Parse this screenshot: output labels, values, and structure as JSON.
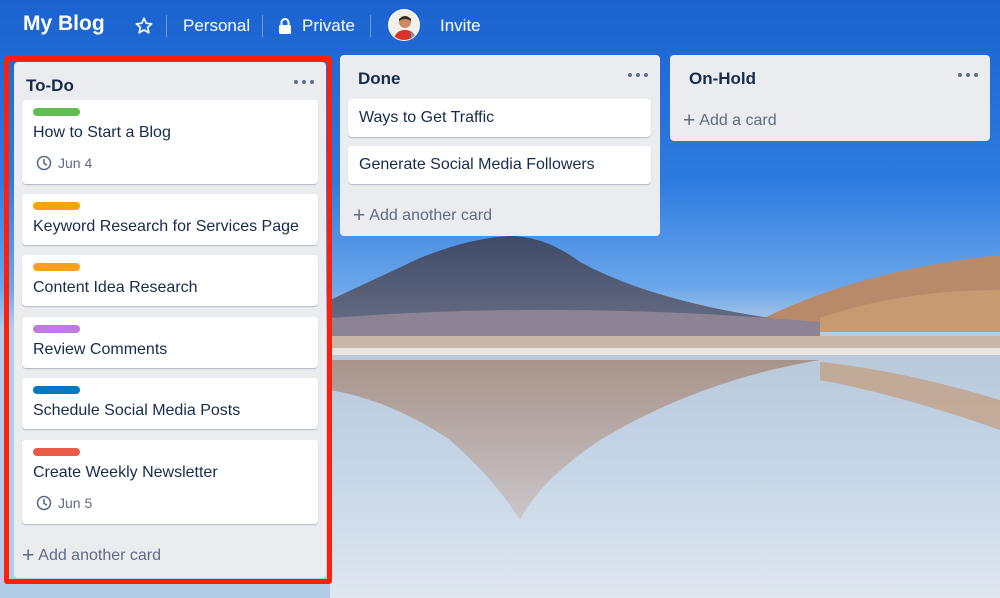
{
  "header": {
    "board_title": "My Blog",
    "star_icon": "star-icon",
    "team_label": "Personal",
    "visibility_label": "Private",
    "visibility_icon": "lock-icon",
    "avatar_icon": "avatar",
    "invite_label": "Invite"
  },
  "lists": {
    "todo": {
      "title": "To-Do",
      "cards": [
        {
          "title": "How to Start a Blog",
          "label_color": "#61bd4f",
          "due": "Jun 4"
        },
        {
          "title": "Keyword Research for Services Page",
          "label_color": "#ff9f1a"
        },
        {
          "title": "Content Idea Research",
          "label_color": "#ff9f1a"
        },
        {
          "title": "Review Comments",
          "label_color": "#c377e0"
        },
        {
          "title": "Schedule Social Media Posts",
          "label_color": "#0079bf"
        },
        {
          "title": "Create Weekly Newsletter",
          "label_color": "#eb5a46",
          "due": "Jun 5"
        }
      ],
      "add_label": "Add another card"
    },
    "done": {
      "title": "Done",
      "cards": [
        {
          "title": "Ways to Get Traffic"
        },
        {
          "title": "Generate Social Media Followers"
        }
      ],
      "add_label": "Add another card"
    },
    "onhold": {
      "title": "On-Hold",
      "add_label": "Add a card"
    }
  },
  "colors": {
    "highlight_border": "#ff1f0a",
    "list_bg": "#ebecf0",
    "sky": "#1f6fd3"
  }
}
